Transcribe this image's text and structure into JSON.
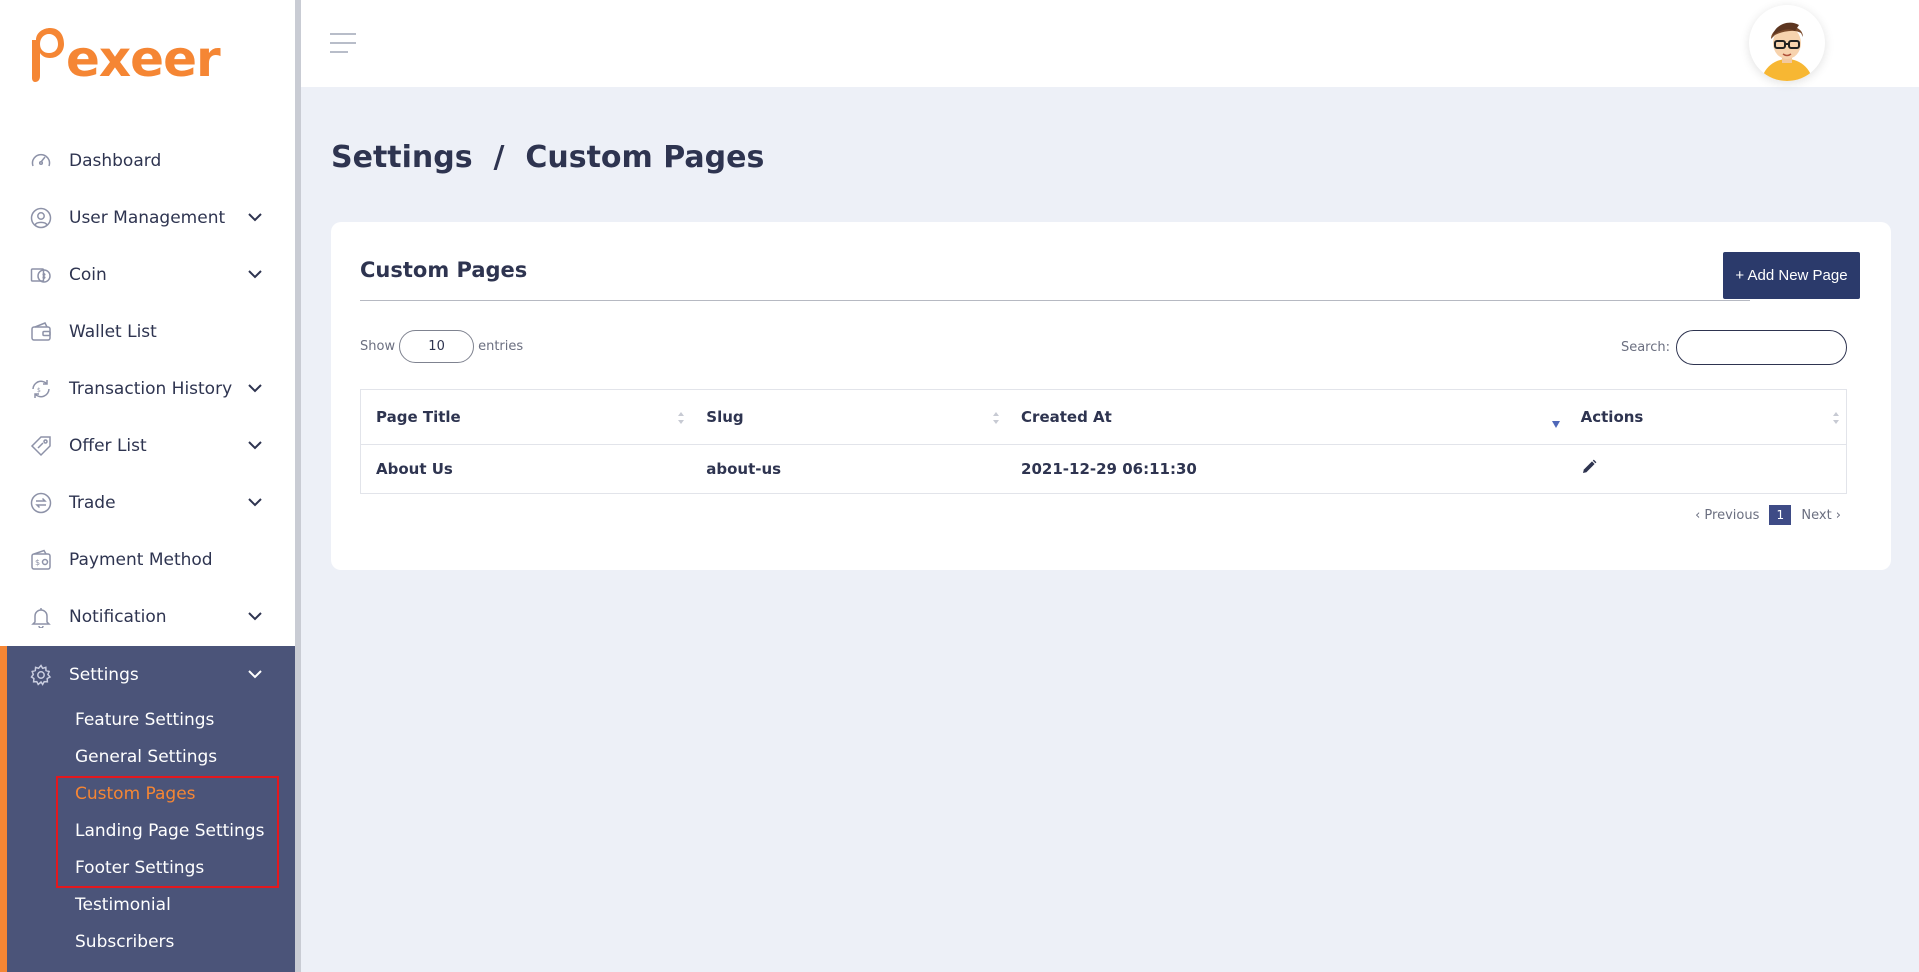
{
  "brand": {
    "logo_text": "exeer",
    "logo_initial": "p",
    "accent": "#f58634",
    "sidebar_active_bg": "#4b5479"
  },
  "sidebar": {
    "items": [
      {
        "label": "Dashboard",
        "icon": "dashboard-gauge-icon",
        "expandable": false
      },
      {
        "label": "User Management",
        "icon": "user-circle-icon",
        "expandable": true
      },
      {
        "label": "Coin",
        "icon": "coin-stack-icon",
        "expandable": true
      },
      {
        "label": "Wallet List",
        "icon": "wallet-icon",
        "expandable": false
      },
      {
        "label": "Transaction History",
        "icon": "transaction-cycle-icon",
        "expandable": true
      },
      {
        "label": "Offer List",
        "icon": "tag-icon",
        "expandable": true
      },
      {
        "label": "Trade",
        "icon": "swap-icon",
        "expandable": true
      },
      {
        "label": "Payment Method",
        "icon": "payment-wallet-icon",
        "expandable": false
      },
      {
        "label": "Notification",
        "icon": "bell-icon",
        "expandable": true
      }
    ],
    "settings": {
      "label": "Settings",
      "icon": "gear-icon",
      "subitems": [
        {
          "label": "Feature Settings",
          "active": false
        },
        {
          "label": "General Settings",
          "active": false
        },
        {
          "label": "Custom Pages",
          "active": true
        },
        {
          "label": "Landing Page Settings",
          "active": false
        },
        {
          "label": "Footer Settings",
          "active": false
        },
        {
          "label": "Testimonial",
          "active": false
        },
        {
          "label": "Subscribers",
          "active": false
        }
      ]
    }
  },
  "page": {
    "breadcrumb": "Settings  /  Custom Pages"
  },
  "card": {
    "title": "Custom Pages",
    "add_button": "+ Add New Page",
    "show_label": "Show",
    "entries_value": "10",
    "entries_label": "entries",
    "search_label": "Search:",
    "search_value": ""
  },
  "table": {
    "columns": [
      "Page Title",
      "Slug",
      "Created At",
      "Actions"
    ],
    "rows": [
      {
        "title": "About Us",
        "slug": "about-us",
        "created_at": "2021-12-29 06:11:30",
        "action_icon": "pencil-edit-icon"
      }
    ]
  },
  "pager": {
    "previous": "‹ Previous",
    "page": "1",
    "next": "Next ›"
  }
}
